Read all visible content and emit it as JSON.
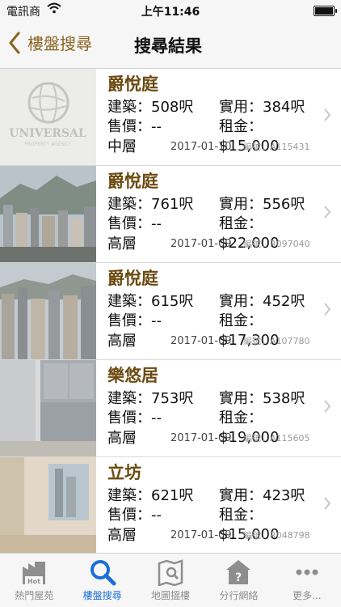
{
  "status": {
    "carrier": "電訊商",
    "time": "上午11:46"
  },
  "nav": {
    "back_label": "樓盤搜尋",
    "title": "搜尋結果"
  },
  "listings": [
    {
      "name": "爵悅庭",
      "area_label": "建築：508呎",
      "usable_label": "實用：384呎",
      "sale_label": "售價：--",
      "rent_label": "租金：$15,000",
      "floor": "中層",
      "date": "2017-01-10",
      "ref": "編號：A115431",
      "thumb_text": "UNIVERSAL",
      "thumb_subtext": "PROPERTY AGENCY"
    },
    {
      "name": "爵悅庭",
      "area_label": "建築：761呎",
      "usable_label": "實用：556呎",
      "sale_label": "售價：--",
      "rent_label": "租金：$22,000",
      "floor": "高層",
      "date": "2017-01-09",
      "ref": "編號：R097040"
    },
    {
      "name": "爵悅庭",
      "area_label": "建築：615呎",
      "usable_label": "實用：452呎",
      "sale_label": "售價：--",
      "rent_label": "租金：$17,300",
      "floor": "高層",
      "date": "2017-01-09",
      "ref": "編號：A107780"
    },
    {
      "name": "樂悠居",
      "area_label": "建築：753呎",
      "usable_label": "實用：538呎",
      "sale_label": "售價：--",
      "rent_label": "租金：$19,000",
      "floor": "高層",
      "date": "2017-01-09",
      "ref": "編號：A115605"
    },
    {
      "name": "立坊",
      "area_label": "建築：621呎",
      "usable_label": "實用：423呎",
      "sale_label": "售價：--",
      "rent_label": "租金：$15,000",
      "floor": "高層",
      "date": "2017-01-09",
      "ref": "編號：R048798"
    }
  ],
  "tabs": [
    {
      "label": "熱門屋苑",
      "icon": "hot-buildings-icon",
      "active": false
    },
    {
      "label": "樓盤搜尋",
      "icon": "search-icon",
      "active": true
    },
    {
      "label": "地圖搵樓",
      "icon": "map-search-icon",
      "active": false
    },
    {
      "label": "分行網絡",
      "icon": "branch-help-icon",
      "active": false
    },
    {
      "label": "更多...",
      "icon": "more-icon",
      "active": false
    }
  ],
  "colors": {
    "accent": "#8a6420",
    "name_color": "#6b4a10",
    "active_tab": "#1a6fd6",
    "inactive_tab": "#8e8e8e"
  },
  "battery_level": 1.0
}
